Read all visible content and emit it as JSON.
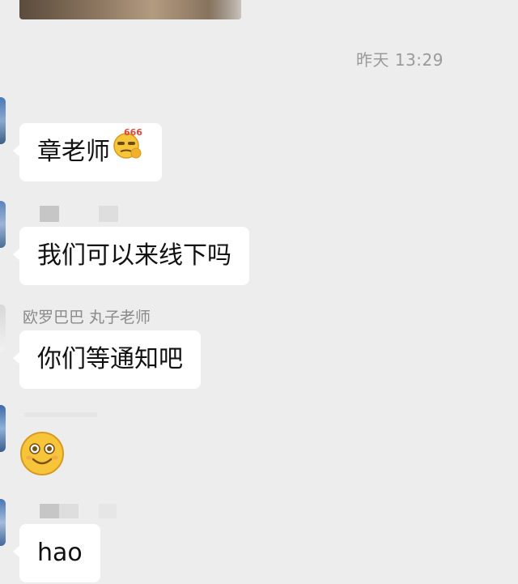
{
  "chat": {
    "timestamp": "昨天 13:29",
    "messages": [
      {
        "text": "章老师",
        "emoji": "666-thinking-emoji"
      },
      {
        "text": "我们可以来线下吗"
      },
      {
        "sender": "欧罗巴巴 丸子老师",
        "text": "你们等通知吧"
      },
      {
        "sticker": "smiling-face-emoji"
      },
      {
        "text": "hao"
      }
    ]
  },
  "colors": {
    "background": "#ededed",
    "bubble": "#ffffff",
    "timestamp": "#9a9a9a",
    "sender": "#8a8a8a",
    "sticker_face": "#f6c53a",
    "badge_text": "#e0483a"
  }
}
